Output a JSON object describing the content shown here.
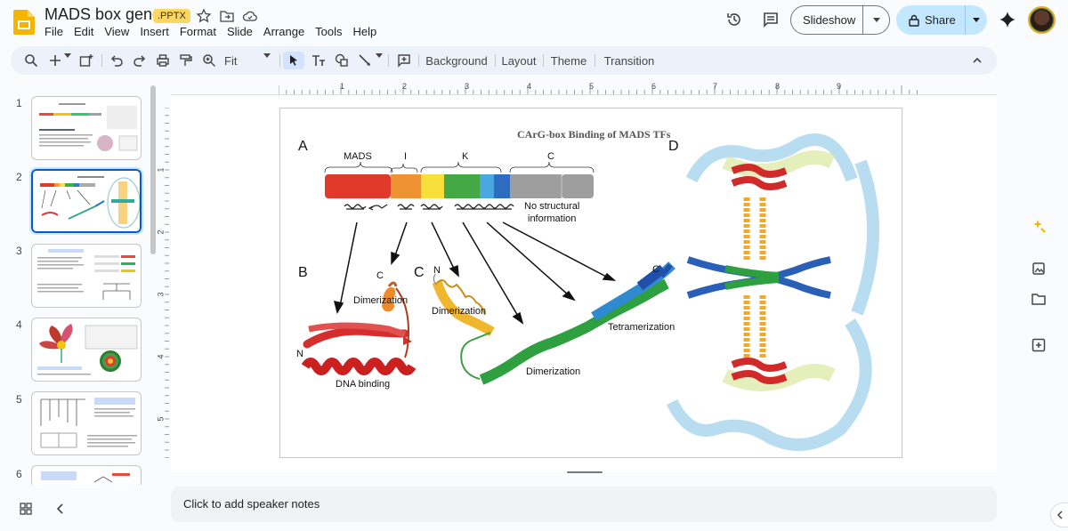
{
  "doc": {
    "title": "MADS box genes",
    "ext_badge": ".PPTX"
  },
  "menu": [
    "File",
    "Edit",
    "View",
    "Insert",
    "Format",
    "Slide",
    "Arrange",
    "Tools",
    "Help"
  ],
  "header": {
    "slideshow_label": "Slideshow",
    "share_label": "Share"
  },
  "toolbar": {
    "zoom": "Fit",
    "background": "Background",
    "layout": "Layout",
    "theme": "Theme",
    "transition": "Transition"
  },
  "filmstrip": {
    "numbers": [
      "1",
      "2",
      "3",
      "4",
      "5",
      "6"
    ],
    "selected": 2
  },
  "ruler": {
    "h": [
      "1",
      "2",
      "3",
      "4",
      "5",
      "6",
      "7",
      "8",
      "9"
    ],
    "v": [
      "1",
      "2",
      "3",
      "4",
      "5"
    ]
  },
  "slide": {
    "title": "CArG-box Binding of MADS TFs",
    "panel_a": "A",
    "panel_b": "B",
    "panel_c": "C",
    "panel_d": "D",
    "domains": {
      "mads": "MADS",
      "i": "I",
      "k": "K",
      "c": "C"
    },
    "no_struct_1": "No structural",
    "no_struct_2": "information",
    "b_c_label": "C",
    "b_n_label": "N",
    "b_dimerization": "Dimerization",
    "b_dna_binding": "DNA binding",
    "c_n_label": "N",
    "c_c_label": "C",
    "c_dimerization_1": "Dimerization",
    "c_dimerization_2": "Dimerization",
    "c_tetramerization": "Tetramerization"
  },
  "notes": {
    "placeholder": "Click to add speaker notes"
  },
  "colors": {
    "accent": "#0b57d0",
    "share_bg": "#c2e7ff",
    "toolbar_bg": "#edf2fa"
  }
}
